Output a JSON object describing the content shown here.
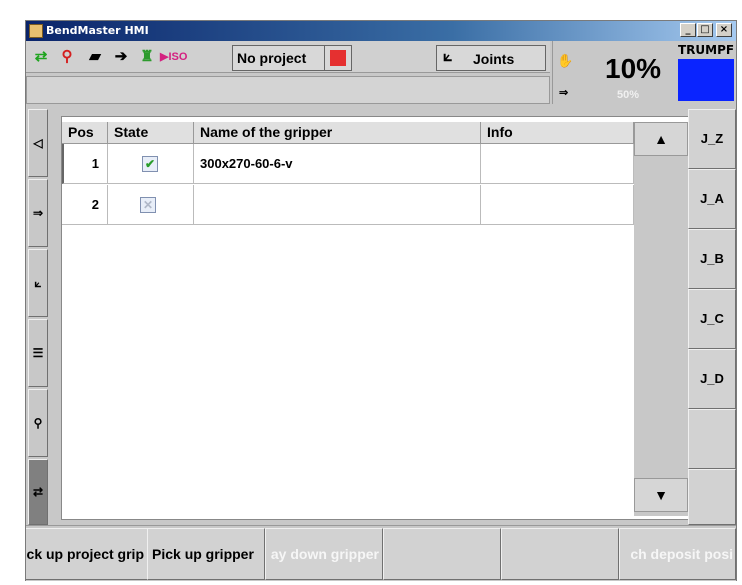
{
  "window": {
    "title": "BendMaster HMI",
    "controls": {
      "minimize": "_",
      "maximize": "□",
      "close": "×"
    }
  },
  "toolbar": {
    "icons": [
      "flip-icon",
      "sensor-icon",
      "tool-icon",
      "arrow-icon",
      "gripper-icon",
      "iso-icon"
    ],
    "project_label": "No project",
    "mode_label": "Joints"
  },
  "speed": {
    "primary": "10%",
    "secondary": "50%"
  },
  "brand": {
    "name": "TRUMPF",
    "accent": "#0a24ff"
  },
  "table": {
    "columns": [
      "Pos",
      "State",
      "Name of the gripper",
      "Info"
    ],
    "rows": [
      {
        "pos": "1",
        "state": "checked",
        "name": "300x270-60-6-v",
        "info": ""
      },
      {
        "pos": "2",
        "state": "unchecked",
        "name": "",
        "info": ""
      }
    ]
  },
  "right_buttons": [
    "J_Z",
    "J_A",
    "J_B",
    "J_C",
    "J_D",
    "",
    ""
  ],
  "bottom_buttons": [
    {
      "label": "ck up project grip",
      "enabled": true
    },
    {
      "label": "Pick up gripper",
      "enabled": true
    },
    {
      "label": "ay down gripper",
      "enabled": false
    },
    {
      "label": "",
      "enabled": false
    },
    {
      "label": "",
      "enabled": false
    },
    {
      "label": "ch deposit posi",
      "enabled": false
    }
  ]
}
